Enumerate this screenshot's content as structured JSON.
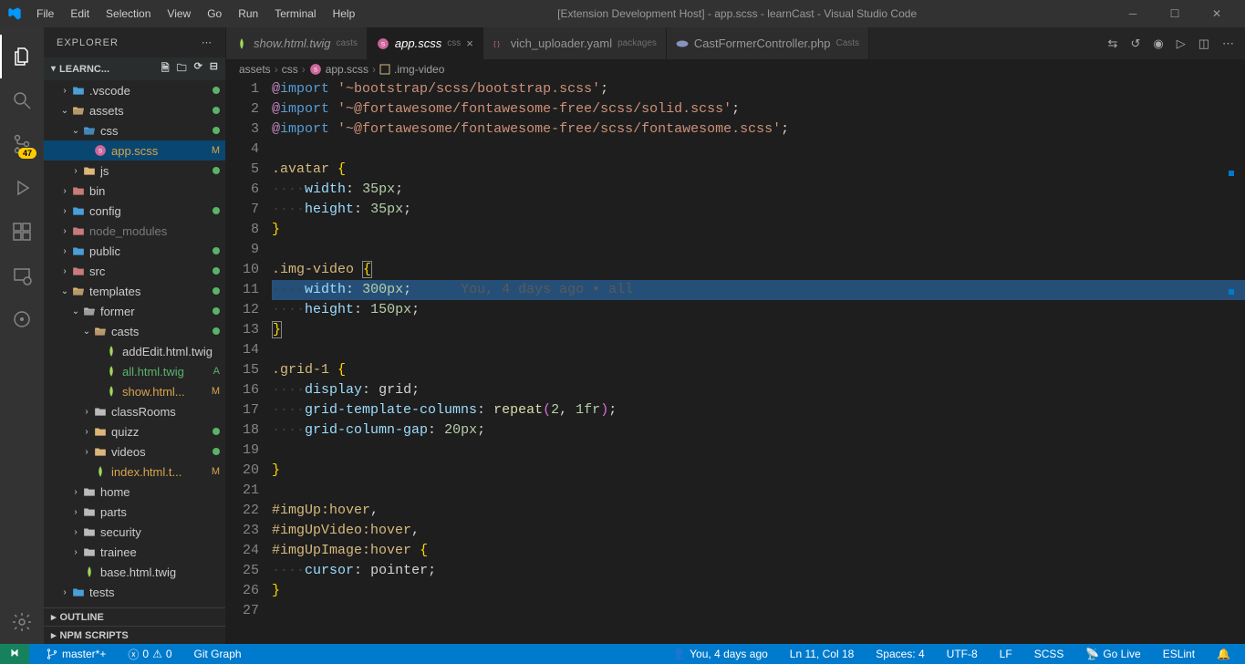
{
  "titlebar": {
    "menu": [
      "File",
      "Edit",
      "Selection",
      "View",
      "Go",
      "Run",
      "Terminal",
      "Help"
    ],
    "title": "[Extension Development Host] - app.scss - learnCast - Visual Studio Code"
  },
  "activitybar": {
    "badge": "47"
  },
  "sidebar": {
    "title": "EXPLORER",
    "project": "LEARNC...",
    "outline": "OUTLINE",
    "npm": "NPM SCRIPTS",
    "tree": [
      {
        "d": 1,
        "t": "folder",
        "name": ".vscode",
        "open": false,
        "color": "folder-blue",
        "dot": "#5bb36a"
      },
      {
        "d": 1,
        "t": "folder",
        "name": "assets",
        "open": true,
        "color": "folder-yellow",
        "dot": "#5bb36a"
      },
      {
        "d": 2,
        "t": "folder",
        "name": "css",
        "open": true,
        "color": "folder-blue",
        "dot": "#5bb36a"
      },
      {
        "d": 3,
        "t": "file",
        "name": "app.scss",
        "icon": "sass",
        "selected": true,
        "git": "M",
        "gitc": "#d9a34b"
      },
      {
        "d": 2,
        "t": "folder",
        "name": "js",
        "open": false,
        "color": "folder-yellow",
        "dot": "#5bb36a"
      },
      {
        "d": 1,
        "t": "folder",
        "name": "bin",
        "open": false,
        "color": "folder-red"
      },
      {
        "d": 1,
        "t": "folder",
        "name": "config",
        "open": false,
        "color": "folder-blue",
        "dot": "#5bb36a"
      },
      {
        "d": 1,
        "t": "folder",
        "name": "node_modules",
        "open": false,
        "color": "folder-red",
        "dim": true
      },
      {
        "d": 1,
        "t": "folder",
        "name": "public",
        "open": false,
        "color": "folder-blue",
        "dot": "#5bb36a"
      },
      {
        "d": 1,
        "t": "folder",
        "name": "src",
        "open": false,
        "color": "folder-red",
        "dot": "#5bb36a"
      },
      {
        "d": 1,
        "t": "folder",
        "name": "templates",
        "open": true,
        "color": "folder-yellow",
        "dot": "#5bb36a"
      },
      {
        "d": 2,
        "t": "folder",
        "name": "former",
        "open": true,
        "color": "folder-grey",
        "dot": "#5bb36a"
      },
      {
        "d": 3,
        "t": "folder",
        "name": "casts",
        "open": true,
        "color": "folder-yellow",
        "dot": "#5bb36a"
      },
      {
        "d": 4,
        "t": "file",
        "name": "addEdit.html.twig",
        "icon": "twig"
      },
      {
        "d": 4,
        "t": "file",
        "name": "all.html.twig",
        "icon": "twig",
        "git": "A",
        "gitc": "#5bb36a"
      },
      {
        "d": 4,
        "t": "file",
        "name": "show.html...",
        "icon": "twig",
        "git": "M",
        "gitc": "#d9a34b"
      },
      {
        "d": 3,
        "t": "folder",
        "name": "classRooms",
        "open": false,
        "color": "folder-grey"
      },
      {
        "d": 3,
        "t": "folder",
        "name": "quizz",
        "open": false,
        "color": "folder-yellow",
        "dot": "#5bb36a"
      },
      {
        "d": 3,
        "t": "folder",
        "name": "videos",
        "open": false,
        "color": "folder-yellow",
        "dot": "#5bb36a"
      },
      {
        "d": 3,
        "t": "file",
        "name": "index.html.t...",
        "icon": "twig",
        "git": "M",
        "gitc": "#d9a34b"
      },
      {
        "d": 2,
        "t": "folder",
        "name": "home",
        "open": false,
        "color": "folder-grey"
      },
      {
        "d": 2,
        "t": "folder",
        "name": "parts",
        "open": false,
        "color": "folder-grey"
      },
      {
        "d": 2,
        "t": "folder",
        "name": "security",
        "open": false,
        "color": "folder-grey"
      },
      {
        "d": 2,
        "t": "folder",
        "name": "trainee",
        "open": false,
        "color": "folder-grey"
      },
      {
        "d": 2,
        "t": "file",
        "name": "base.html.twig",
        "icon": "twig"
      },
      {
        "d": 1,
        "t": "folder",
        "name": "tests",
        "open": false,
        "color": "folder-blue"
      }
    ]
  },
  "tabs": [
    {
      "icon": "twig",
      "label": "show.html.twig",
      "desc": "casts",
      "italic": true
    },
    {
      "icon": "sass",
      "label": "app.scss",
      "desc": "css",
      "italic": true,
      "active": true,
      "close": true
    },
    {
      "icon": "yaml",
      "label": "vich_uploader.yaml",
      "desc": "packages"
    },
    {
      "icon": "php",
      "label": "CastFormerController.php",
      "desc": "Casts"
    }
  ],
  "breadcrumb": [
    "assets",
    "css",
    "app.scss",
    ".img-video"
  ],
  "editor": {
    "ghost": "You, 4 days ago • all",
    "lines": 27
  },
  "statusbar": {
    "branch": "master*+",
    "errors": "0",
    "warnings": "0",
    "gitgraph": "Git Graph",
    "blame": "You, 4 days ago",
    "lncol": "Ln 11, Col 18",
    "spaces": "Spaces: 4",
    "enc": "UTF-8",
    "eol": "LF",
    "lang": "SCSS",
    "golive": "Go Live",
    "eslint": "ESLint"
  }
}
